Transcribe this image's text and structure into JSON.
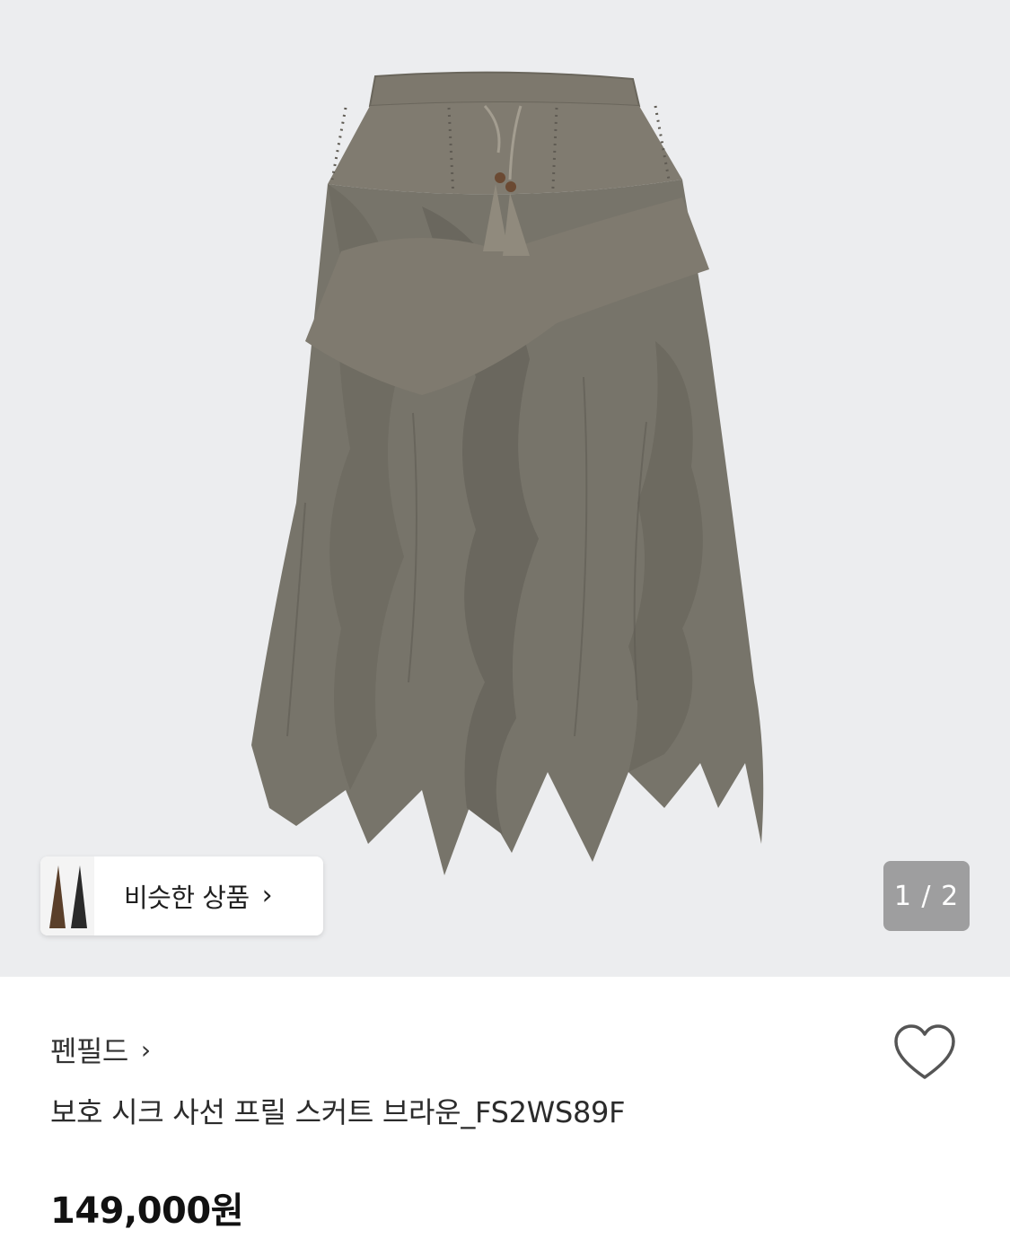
{
  "gallery": {
    "background": "#ecedef",
    "image_alt": "skirt-product-photo",
    "current_page": "1",
    "total_pages": "2",
    "counter_text": "1 / 2",
    "similar_products_label": "비슷한 상품",
    "similar_products_icon": "chevron-right-icon"
  },
  "product": {
    "brand": "펜필드",
    "brand_icon": "chevron-right-icon",
    "title": "보호 시크 사선 프릴 스커트 브라운_FS2WS89F",
    "price": "149,000원",
    "wishlist_icon": "heart-outline-icon",
    "skirt_color": "#77746a"
  }
}
